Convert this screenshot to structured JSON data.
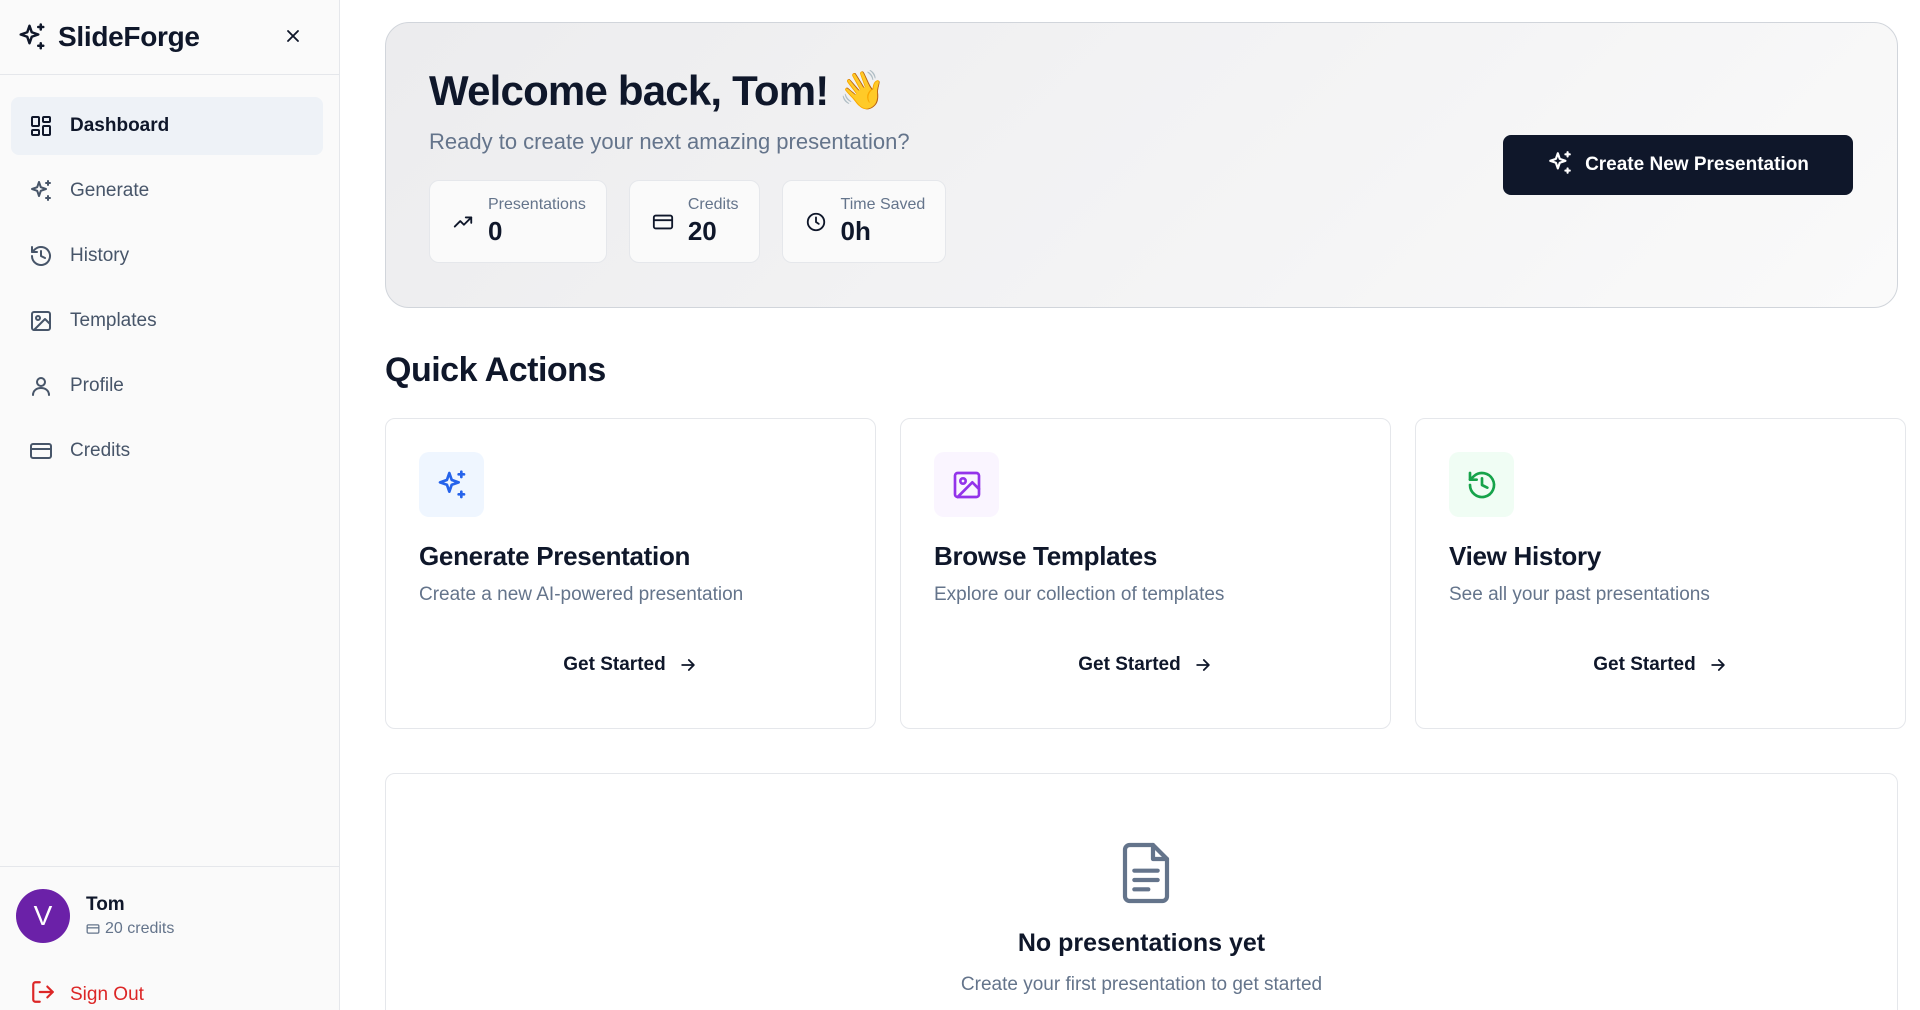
{
  "app": {
    "name": "SlideForge"
  },
  "sidebar": {
    "items": [
      {
        "label": "Dashboard",
        "icon": "layout-dashboard-icon",
        "active": true
      },
      {
        "label": "Generate",
        "icon": "sparkles-icon"
      },
      {
        "label": "History",
        "icon": "history-icon"
      },
      {
        "label": "Templates",
        "icon": "image-icon"
      },
      {
        "label": "Profile",
        "icon": "user-icon"
      },
      {
        "label": "Credits",
        "icon": "credit-card-icon"
      }
    ],
    "user": {
      "initial": "V",
      "name": "Tom",
      "credits": "20 credits"
    },
    "sign_out": "Sign Out"
  },
  "hero": {
    "title": "Welcome back, Tom!",
    "emoji": "👋",
    "subtitle": "Ready to create your next amazing presentation?",
    "stats": [
      {
        "label": "Presentations",
        "value": "0",
        "icon": "trending-up-icon"
      },
      {
        "label": "Credits",
        "value": "20",
        "icon": "credit-card-icon"
      },
      {
        "label": "Time Saved",
        "value": "0h",
        "icon": "clock-icon"
      }
    ],
    "cta": "Create New Presentation"
  },
  "quick_actions": {
    "title": "Quick Actions",
    "cards": [
      {
        "title": "Generate Presentation",
        "desc": "Create a new AI-powered presentation",
        "cta": "Get Started",
        "icon": "sparkles-icon",
        "accent": "#2563eb",
        "bg": "#eff6ff"
      },
      {
        "title": "Browse Templates",
        "desc": "Explore our collection of templates",
        "cta": "Get Started",
        "icon": "image-icon",
        "accent": "#9333ea",
        "bg": "#faf5ff"
      },
      {
        "title": "View History",
        "desc": "See all your past presentations",
        "cta": "Get Started",
        "icon": "history-icon",
        "accent": "#16a34a",
        "bg": "#f0fdf4"
      }
    ]
  },
  "empty_state": {
    "title": "No presentations yet",
    "subtitle": "Create your first presentation to get started",
    "icon": "file-text-icon"
  },
  "colors": {
    "primary": "#0f172a",
    "muted": "#64748b",
    "danger": "#dc2626",
    "avatar": "#6b21a8"
  }
}
